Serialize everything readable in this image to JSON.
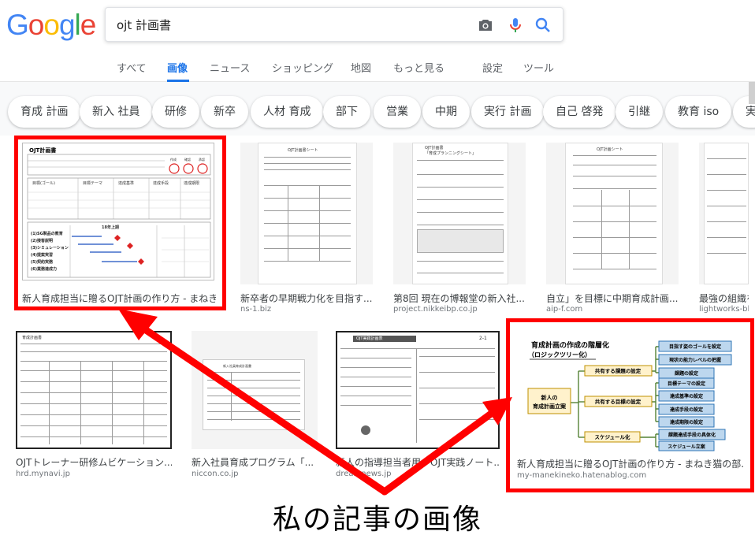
{
  "logo": {
    "letters": [
      {
        "char": "G",
        "color": "#4285F4"
      },
      {
        "char": "o",
        "color": "#EA4335"
      },
      {
        "char": "o",
        "color": "#FBBC05"
      },
      {
        "char": "g",
        "color": "#4285F4"
      },
      {
        "char": "l",
        "color": "#34A853"
      },
      {
        "char": "e",
        "color": "#EA4335"
      }
    ]
  },
  "search": {
    "value": "ojt 計画書",
    "icons": [
      "camera-icon",
      "mic-icon",
      "search-icon"
    ]
  },
  "tabs": [
    {
      "label": "すべて",
      "active": false
    },
    {
      "label": "画像",
      "active": true
    },
    {
      "label": "ニュース",
      "active": false
    },
    {
      "label": "ショッピング",
      "active": false
    },
    {
      "label": "地図",
      "active": false
    },
    {
      "label": "もっと見る",
      "active": false
    },
    {
      "label": "設定",
      "active": false
    },
    {
      "label": "ツール",
      "active": false
    }
  ],
  "chips": [
    "育成 計画",
    "新入 社員",
    "研修",
    "新卒",
    "人材 育成",
    "部下",
    "営業",
    "中期",
    "実行 計画",
    "自己 啓発",
    "引継",
    "教育 iso",
    "実"
  ],
  "results_row1": [
    {
      "caption": "新人育成担当に贈るOJT計画の作り方 - まねき...",
      "source": ""
    },
    {
      "caption": "新卒者の早期戦力化を目指す...",
      "source": "ns-1.biz"
    },
    {
      "caption": "第8回 現在の博報堂の新入社...",
      "source": "project.nikkeibp.co.jp"
    },
    {
      "caption": "自立」を目標に中期育成計画...",
      "source": "aip-f.com"
    },
    {
      "caption": "最強の組織を",
      "source": "lightworks-blo"
    }
  ],
  "results_row2": [
    {
      "caption": "OJTトレーナー研修ムビケーション...",
      "source": "hrd.mynavi.jp"
    },
    {
      "caption": "新入社員育成プログラム「...",
      "source": "niccon.co.jp"
    },
    {
      "caption": "新人の指導担当者用「OJT実践ノート...",
      "source": "dreamnews.jp"
    },
    {
      "caption": "新人育成担当に贈るOJT計画の作り方 - まねき猫の部...",
      "source": "my-manekineko.hatenablog.com"
    }
  ],
  "thumb1": {
    "title": "OJT計画書",
    "circle_labels": [
      "作成",
      "確認",
      "承認"
    ],
    "row_texts": [
      "目標(ゴール)",
      "目標テーマ",
      "達成基準",
      "達成手段",
      "達成期限"
    ],
    "sub_header": "18年上期",
    "list_items": [
      "(1)SG製品の教育",
      "(2)接客説明",
      "(3)シミュレーション",
      "(4)提案実習",
      "(5)契約実務",
      "(6)業務達成力"
    ]
  },
  "thumb2": {
    "header": "OJT計画書シート"
  },
  "thumb3": {
    "header": "OJT計画書",
    "subheader": "「育成プランニングシート」"
  },
  "thumb4": {
    "header": "OJT計画シート"
  },
  "thumb_r2a": {
    "header": "育成計画書"
  },
  "thumb_r2b": {
    "header": "新入社員育成計画書"
  },
  "thumb_r2c": {
    "header": "OJT実践計画表",
    "badge": "2-1"
  },
  "logic_tree": {
    "title": "育成計画の作成の階層化",
    "subtitle": "（ロジックツリー化）",
    "root": "新人の\n育成計画立案",
    "branches": [
      {
        "label": "共有する課題の設定",
        "leaves": [
          "目指す姿のゴールを設定",
          "現状の能力レベルの把握",
          "課題の設定"
        ]
      },
      {
        "label": "共有する目標の設定",
        "leaves": [
          "目標テーマの設定",
          "達成基準の設定",
          "達成手段の設定",
          "達成期限の設定"
        ]
      },
      {
        "label": "スケジュール化",
        "leaves": [
          "課題達成手段の具体化",
          "スケジュール立案"
        ]
      }
    ]
  },
  "annotation": {
    "text": "私の記事の画像"
  },
  "colors": {
    "accent": "#1a73e8",
    "highlight": "#ff0000",
    "tree_box": "#bdd7ee",
    "tree_border": "#2e75b6",
    "tree_root": "#fff2cc",
    "tree_line": "#70ad47"
  }
}
